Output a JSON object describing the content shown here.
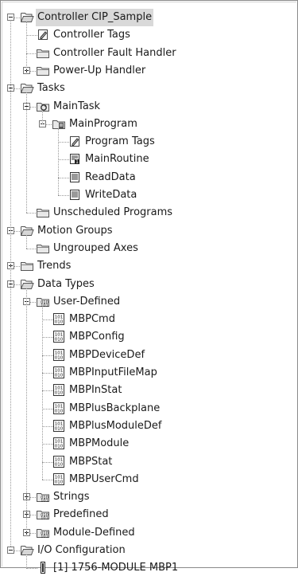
{
  "tree": [
    {
      "id": "controller",
      "label": "Controller CIP_Sample",
      "level": 0,
      "toggle": "minus",
      "icon": "folder-open-icon",
      "selected": true
    },
    {
      "id": "controller-tags",
      "label": "Controller Tags",
      "level": 1,
      "icon": "tags-icon"
    },
    {
      "id": "controller-fault-handler",
      "label": "Controller Fault Handler",
      "level": 1,
      "icon": "folder-icon"
    },
    {
      "id": "power-up-handler",
      "label": "Power-Up Handler",
      "level": 1,
      "toggle": "plus",
      "icon": "folder-icon"
    },
    {
      "id": "tasks",
      "label": "Tasks",
      "level": 0,
      "toggle": "minus",
      "icon": "folder-open-icon"
    },
    {
      "id": "main-task",
      "label": "MainTask",
      "level": 1,
      "toggle": "minus",
      "icon": "task-icon"
    },
    {
      "id": "main-program",
      "label": "MainProgram",
      "level": 2,
      "toggle": "minus",
      "icon": "program-icon"
    },
    {
      "id": "program-tags",
      "label": "Program Tags",
      "level": 3,
      "icon": "tags-icon"
    },
    {
      "id": "main-routine",
      "label": "MainRoutine",
      "level": 3,
      "icon": "main-routine-icon"
    },
    {
      "id": "read-data",
      "label": "ReadData",
      "level": 3,
      "icon": "routine-icon"
    },
    {
      "id": "write-data",
      "label": "WriteData",
      "level": 3,
      "icon": "routine-icon"
    },
    {
      "id": "unscheduled-programs",
      "label": "Unscheduled Programs",
      "level": 1,
      "icon": "folder-icon"
    },
    {
      "id": "motion-groups",
      "label": "Motion Groups",
      "level": 0,
      "toggle": "minus",
      "icon": "folder-open-icon"
    },
    {
      "id": "ungrouped-axes",
      "label": "Ungrouped Axes",
      "level": 1,
      "icon": "folder-icon"
    },
    {
      "id": "trends",
      "label": "Trends",
      "level": 0,
      "toggle": "plus",
      "icon": "folder-icon"
    },
    {
      "id": "data-types",
      "label": "Data Types",
      "level": 0,
      "toggle": "minus",
      "icon": "folder-open-icon"
    },
    {
      "id": "user-defined",
      "label": "User-Defined",
      "level": 1,
      "toggle": "minus",
      "icon": "datatype-folder-icon"
    },
    {
      "id": "mbpcmd",
      "label": "MBPCmd",
      "level": 2,
      "icon": "datatype-icon"
    },
    {
      "id": "mbpconfig",
      "label": "MBPConfig",
      "level": 2,
      "icon": "datatype-icon"
    },
    {
      "id": "mbpdevicedef",
      "label": "MBPDeviceDef",
      "level": 2,
      "icon": "datatype-icon"
    },
    {
      "id": "mbpinputfilemap",
      "label": "MBPInputFileMap",
      "level": 2,
      "icon": "datatype-icon"
    },
    {
      "id": "mbpinstat",
      "label": "MBPInStat",
      "level": 2,
      "icon": "datatype-icon"
    },
    {
      "id": "mbplusbackplane",
      "label": "MBPlusBackplane",
      "level": 2,
      "icon": "datatype-icon"
    },
    {
      "id": "mbplusmoduledef",
      "label": "MBPlusModuleDef",
      "level": 2,
      "icon": "datatype-icon"
    },
    {
      "id": "mbpmodule",
      "label": "MBPModule",
      "level": 2,
      "icon": "datatype-icon"
    },
    {
      "id": "mbpstat",
      "label": "MBPStat",
      "level": 2,
      "icon": "datatype-icon"
    },
    {
      "id": "mbpusercmd",
      "label": "MBPUserCmd",
      "level": 2,
      "icon": "datatype-icon"
    },
    {
      "id": "strings",
      "label": "Strings",
      "level": 1,
      "toggle": "plus",
      "icon": "datatype-folder-icon"
    },
    {
      "id": "predefined",
      "label": "Predefined",
      "level": 1,
      "toggle": "plus",
      "icon": "datatype-folder-icon"
    },
    {
      "id": "module-defined",
      "label": "Module-Defined",
      "level": 1,
      "toggle": "plus",
      "icon": "datatype-folder-icon"
    },
    {
      "id": "io-configuration",
      "label": "I/O Configuration",
      "level": 0,
      "toggle": "minus",
      "icon": "folder-open-icon"
    },
    {
      "id": "module-1756",
      "label": "[1] 1756-MODULE MBP1",
      "level": 1,
      "icon": "module-icon"
    }
  ]
}
